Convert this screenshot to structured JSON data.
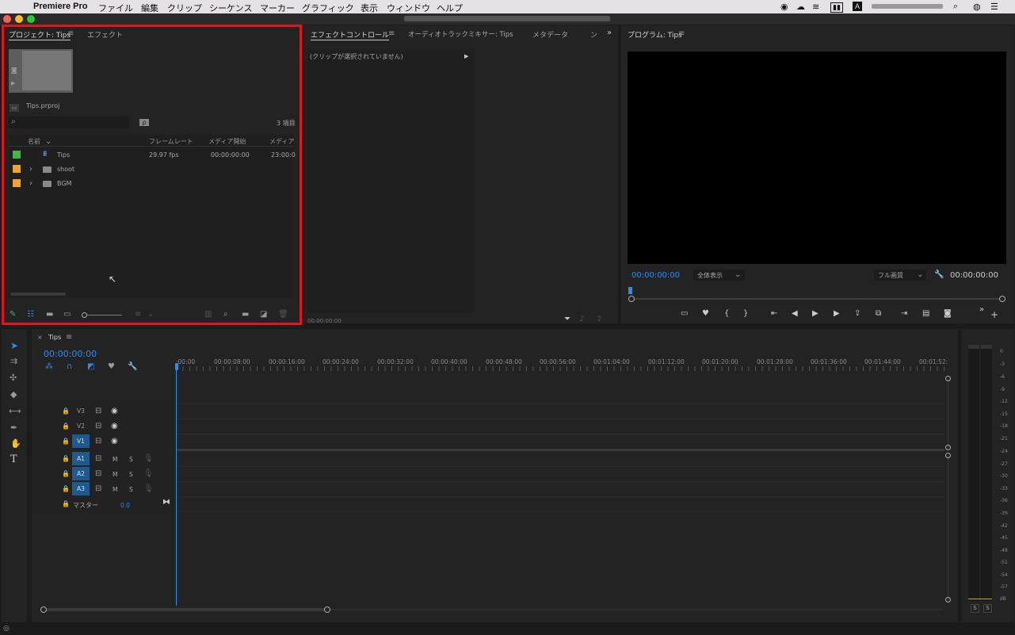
{
  "menubar": {
    "app_name": "Premiere Pro",
    "items": [
      "ファイル",
      "編集",
      "クリップ",
      "シーケンス",
      "マーカー",
      "グラフィック",
      "表示",
      "ウィンドウ",
      "ヘルプ"
    ],
    "status_icons": [
      "record-icon",
      "creative-cloud-icon",
      "wifi-icon",
      "battery-icon",
      "input-source-icon",
      "search-icon",
      "siri-icon",
      "notification-center-icon"
    ],
    "input_source": "A"
  },
  "project_panel": {
    "tab_project": "プロジェクト: Tips",
    "tab_effects": "エフェクト",
    "project_file": "Tips.prproj",
    "item_count": "3 項目",
    "search_placeholder": "",
    "columns": [
      "名前",
      "フレームレート",
      "メディア開始",
      "メディア"
    ],
    "rows": [
      {
        "color": "#45b649",
        "name": "Tips",
        "framerate": "29.97 fps",
        "media_start": "00:00:00:00",
        "media_end": "23:00:0",
        "type": "sequence"
      },
      {
        "color": "#f0a430",
        "name": "shoot",
        "framerate": "",
        "media_start": "",
        "media_end": "",
        "type": "bin"
      },
      {
        "color": "#f0a430",
        "name": "BGM",
        "framerate": "",
        "media_start": "",
        "media_end": "",
        "type": "bin"
      }
    ],
    "highlight_color": "#e0151d"
  },
  "effect_controls": {
    "tab_effect_controls": "エフェクトコントロール",
    "tab_audio_mixer": "オーディオトラックミキサー: Tips",
    "tab_metadata": "メタデータ",
    "tab_more": "ン",
    "no_clip_message": "(クリップが選択されていません)",
    "timecode": "00:00:00:00"
  },
  "program_monitor": {
    "title": "プログラム: Tips",
    "timecode_current": "00:00:00:00",
    "zoom_option": "全体表示",
    "quality_option": "フル画質",
    "timecode_duration": "00:00:00:00"
  },
  "timeline": {
    "sequence_tab": "Tips",
    "timecode": "00:00:00:00",
    "ruler": [
      ":00:00",
      "00:00:08:00",
      "00:00:16:00",
      "00:00:24:00",
      "00:00:32:00",
      "00:00:40:00",
      "00:00:48:00",
      "00:00:56:00",
      "00:01:04:00",
      "00:01:12:00",
      "00:01:20:00",
      "00:01:28:00",
      "00:01:36:00",
      "00:01:44:00",
      "00:01:52:"
    ],
    "video_tracks": [
      "V3",
      "V2",
      "V1"
    ],
    "audio_tracks": [
      "A1",
      "A2",
      "A3"
    ],
    "mute_label": "M",
    "solo_label": "S",
    "master_label": "マスター",
    "master_value": "0.0"
  },
  "audio_meter": {
    "scale": [
      "0",
      "-3",
      "-6",
      "-9",
      "-12",
      "-15",
      "-18",
      "-21",
      "-24",
      "-27",
      "-30",
      "-33",
      "-36",
      "-39",
      "-42",
      "-45",
      "-48",
      "-51",
      "-54",
      "-57",
      "dB"
    ],
    "solo_buttons": [
      "S",
      "S"
    ]
  },
  "colors": {
    "accent_blue": "#2d8ceb",
    "selection_red": "#e0151d"
  }
}
